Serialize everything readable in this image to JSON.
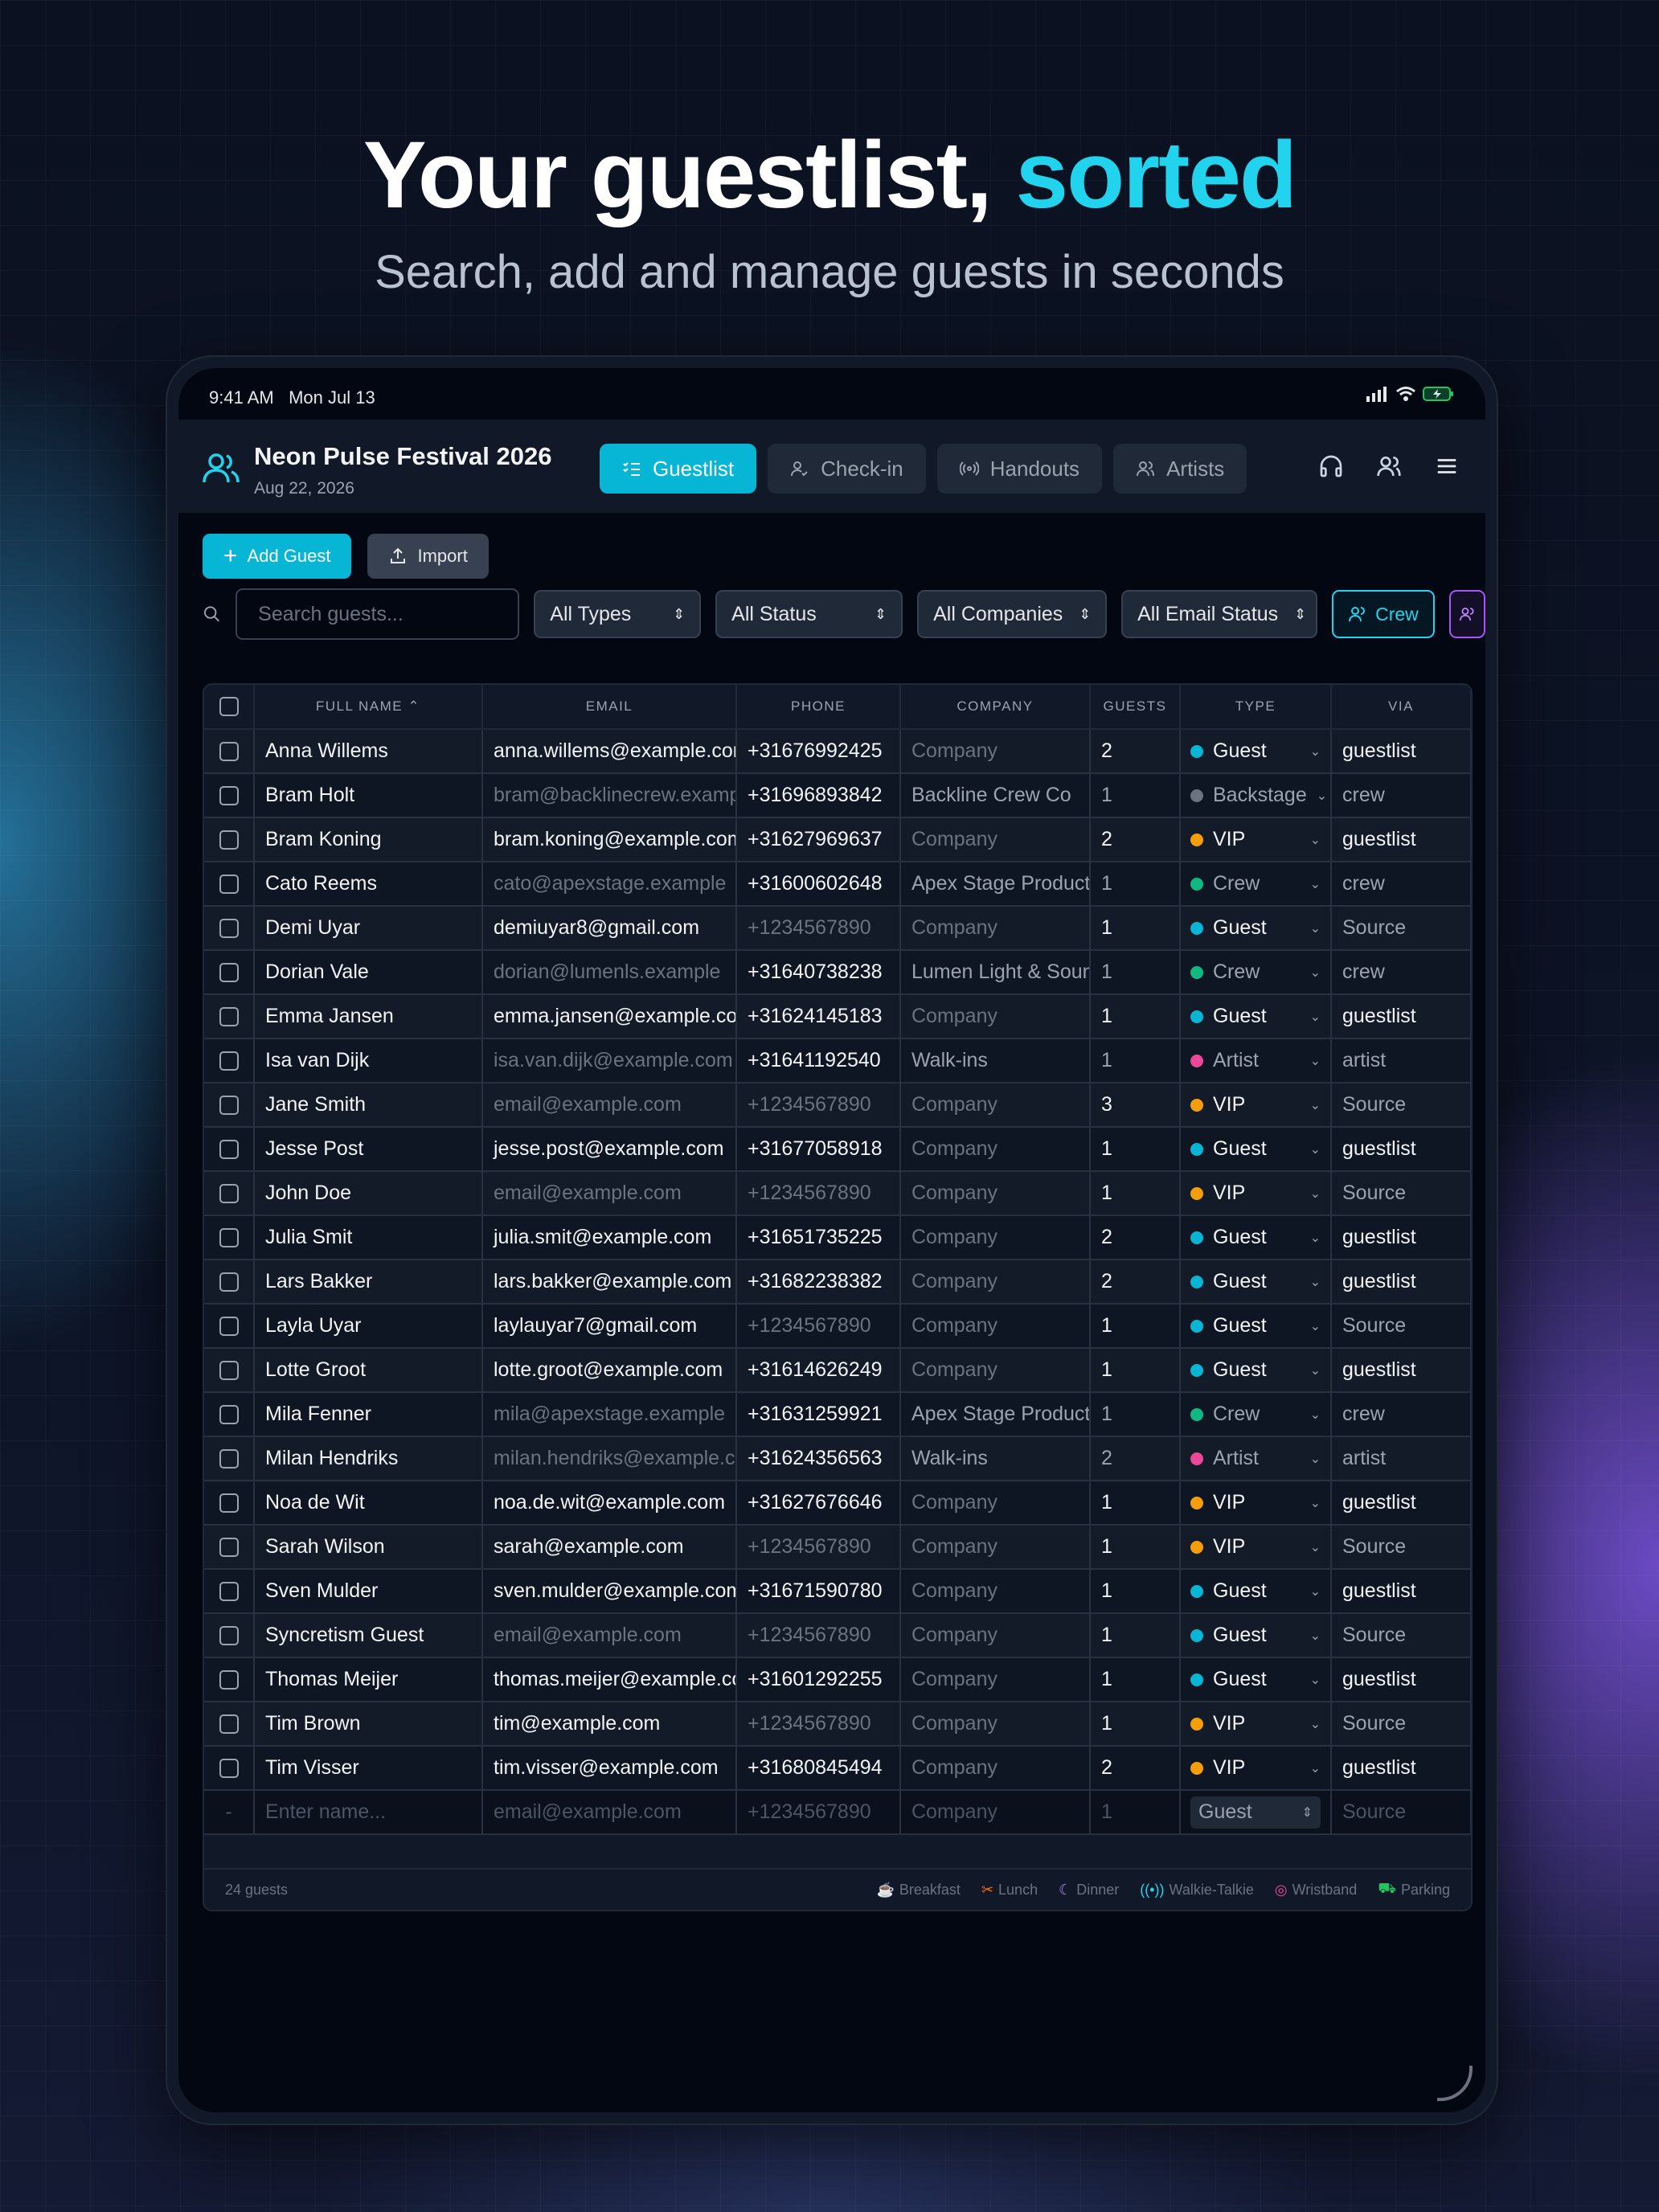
{
  "hero": {
    "title_main": "Your guestlist, ",
    "title_accent": "sorted",
    "subtitle": "Search, add and manage guests in seconds"
  },
  "status_bar": {
    "time": "9:41 AM",
    "date": "Mon Jul 13"
  },
  "event": {
    "name": "Neon Pulse Festival 2026",
    "date": "Aug 22, 2026"
  },
  "tabs": [
    {
      "label": "Guestlist",
      "icon": "list-check-icon",
      "active": true
    },
    {
      "label": "Check-in",
      "icon": "user-check-icon",
      "active": false
    },
    {
      "label": "Handouts",
      "icon": "broadcast-icon",
      "active": false
    },
    {
      "label": "Artists",
      "icon": "users-icon",
      "active": false
    }
  ],
  "actions": {
    "add_guest": "Add Guest",
    "import": "Import"
  },
  "filters": {
    "search_placeholder": "Search guests...",
    "types": "All Types",
    "status": "All Status",
    "companies": "All Companies",
    "email_status": "All Email Status",
    "crew_chip": "Crew"
  },
  "table": {
    "columns": [
      "FULL NAME",
      "EMAIL",
      "PHONE",
      "COMPANY",
      "GUESTS",
      "TYPE",
      "VIA"
    ],
    "sort_indicator": "⌃",
    "rows": [
      {
        "name": "Anna Willems",
        "email": "anna.willems@example.com",
        "phone": "+31676992425",
        "company": "Company",
        "guests": "2",
        "type": "Guest",
        "via": "guestlist"
      },
      {
        "name": "Bram Holt",
        "email": "bram@backlinecrew.example",
        "phone": "+31696893842",
        "company": "Backline Crew Co",
        "guests": "1",
        "type": "Backstage",
        "via": "crew"
      },
      {
        "name": "Bram Koning",
        "email": "bram.koning@example.com",
        "phone": "+31627969637",
        "company": "Company",
        "guests": "2",
        "type": "VIP",
        "via": "guestlist"
      },
      {
        "name": "Cato Reems",
        "email": "cato@apexstage.example",
        "phone": "+31600602648",
        "company": "Apex Stage Productions",
        "guests": "1",
        "type": "Crew",
        "via": "crew"
      },
      {
        "name": "Demi Uyar",
        "email": "demiuyar8@gmail.com",
        "phone": "+1234567890",
        "company": "Company",
        "guests": "1",
        "type": "Guest",
        "via": "Source"
      },
      {
        "name": "Dorian Vale",
        "email": "dorian@lumenls.example",
        "phone": "+31640738238",
        "company": "Lumen Light & Sound",
        "guests": "1",
        "type": "Crew",
        "via": "crew"
      },
      {
        "name": "Emma Jansen",
        "email": "emma.jansen@example.com",
        "phone": "+31624145183",
        "company": "Company",
        "guests": "1",
        "type": "Guest",
        "via": "guestlist"
      },
      {
        "name": "Isa van Dijk",
        "email": "isa.van.dijk@example.com",
        "phone": "+31641192540",
        "company": "Walk-ins",
        "guests": "1",
        "type": "Artist",
        "via": "artist"
      },
      {
        "name": "Jane Smith",
        "email": "email@example.com",
        "phone": "+1234567890",
        "company": "Company",
        "guests": "3",
        "type": "VIP",
        "via": "Source"
      },
      {
        "name": "Jesse Post",
        "email": "jesse.post@example.com",
        "phone": "+31677058918",
        "company": "Company",
        "guests": "1",
        "type": "Guest",
        "via": "guestlist"
      },
      {
        "name": "John Doe",
        "email": "email@example.com",
        "phone": "+1234567890",
        "company": "Company",
        "guests": "1",
        "type": "VIP",
        "via": "Source"
      },
      {
        "name": "Julia Smit",
        "email": "julia.smit@example.com",
        "phone": "+31651735225",
        "company": "Company",
        "guests": "2",
        "type": "Guest",
        "via": "guestlist"
      },
      {
        "name": "Lars Bakker",
        "email": "lars.bakker@example.com",
        "phone": "+31682238382",
        "company": "Company",
        "guests": "2",
        "type": "Guest",
        "via": "guestlist"
      },
      {
        "name": "Layla Uyar",
        "email": "laylauyar7@gmail.com",
        "phone": "+1234567890",
        "company": "Company",
        "guests": "1",
        "type": "Guest",
        "via": "Source"
      },
      {
        "name": "Lotte Groot",
        "email": "lotte.groot@example.com",
        "phone": "+31614626249",
        "company": "Company",
        "guests": "1",
        "type": "Guest",
        "via": "guestlist"
      },
      {
        "name": "Mila Fenner",
        "email": "mila@apexstage.example",
        "phone": "+31631259921",
        "company": "Apex Stage Productions",
        "guests": "1",
        "type": "Crew",
        "via": "crew"
      },
      {
        "name": "Milan Hendriks",
        "email": "milan.hendriks@example.com",
        "phone": "+31624356563",
        "company": "Walk-ins",
        "guests": "2",
        "type": "Artist",
        "via": "artist"
      },
      {
        "name": "Noa de Wit",
        "email": "noa.de.wit@example.com",
        "phone": "+31627676646",
        "company": "Company",
        "guests": "1",
        "type": "VIP",
        "via": "guestlist"
      },
      {
        "name": "Sarah Wilson",
        "email": "sarah@example.com",
        "phone": "+1234567890",
        "company": "Company",
        "guests": "1",
        "type": "VIP",
        "via": "Source"
      },
      {
        "name": "Sven Mulder",
        "email": "sven.mulder@example.com",
        "phone": "+31671590780",
        "company": "Company",
        "guests": "1",
        "type": "Guest",
        "via": "guestlist"
      },
      {
        "name": "Syncretism Guest",
        "email": "email@example.com",
        "phone": "+1234567890",
        "company": "Company",
        "guests": "1",
        "type": "Guest",
        "via": "Source"
      },
      {
        "name": "Thomas Meijer",
        "email": "thomas.meijer@example.com",
        "phone": "+31601292255",
        "company": "Company",
        "guests": "1",
        "type": "Guest",
        "via": "guestlist"
      },
      {
        "name": "Tim Brown",
        "email": "tim@example.com",
        "phone": "+1234567890",
        "company": "Company",
        "guests": "1",
        "type": "VIP",
        "via": "Source"
      },
      {
        "name": "Tim Visser",
        "email": "tim.visser@example.com",
        "phone": "+31680845494",
        "company": "Company",
        "guests": "2",
        "type": "VIP",
        "via": "guestlist"
      }
    ],
    "new_row": {
      "marker": "-",
      "name": "Enter name...",
      "email": "email@example.com",
      "phone": "+1234567890",
      "company": "Company",
      "guests": "1",
      "type": "Guest",
      "via": "Source"
    }
  },
  "type_colors": {
    "Guest": "#06b6d4",
    "VIP": "#f59e0b",
    "Crew": "#10b981",
    "Artist": "#ec4899",
    "Backstage": "#6b7280"
  },
  "footer": {
    "count": "24 guests",
    "legend": [
      {
        "label": "Breakfast",
        "icon": "coffee-icon",
        "color": "#f59e0b"
      },
      {
        "label": "Lunch",
        "icon": "utensils-icon",
        "color": "#f97316"
      },
      {
        "label": "Dinner",
        "icon": "moon-icon",
        "color": "#a78bfa"
      },
      {
        "label": "Walkie-Talkie",
        "icon": "radio-icon",
        "color": "#22d3ee"
      },
      {
        "label": "Wristband",
        "icon": "wristband-icon",
        "color": "#ec4899"
      },
      {
        "label": "Parking",
        "icon": "car-icon",
        "color": "#22c55e"
      }
    ]
  }
}
